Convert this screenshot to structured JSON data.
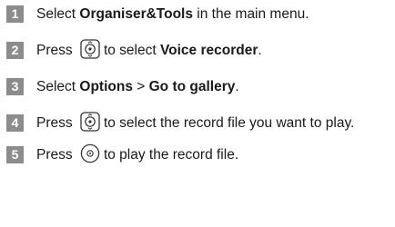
{
  "steps": [
    {
      "number": "1",
      "parts": [
        "Select ",
        "Organiser&Tools",
        " in the main menu."
      ]
    },
    {
      "number": "2",
      "parts": [
        "Press ",
        "to select ",
        "Voice recorder",
        "."
      ],
      "key_icon": "navigation-key-icon"
    },
    {
      "number": "3",
      "parts": [
        "Select ",
        "Options",
        " > ",
        "Go to gallery",
        "."
      ]
    },
    {
      "number": "4",
      "parts": [
        "Press ",
        "to select the record file you want to play."
      ],
      "key_icon": "navigation-key-icon"
    },
    {
      "number": "5",
      "parts": [
        "Press ",
        "to play the record file."
      ],
      "key_icon": "confirm-key-icon"
    }
  ],
  "colors": {
    "step_badge": "#8c8c8c",
    "text": "#1a1a1a",
    "key_stroke": "#333333"
  }
}
